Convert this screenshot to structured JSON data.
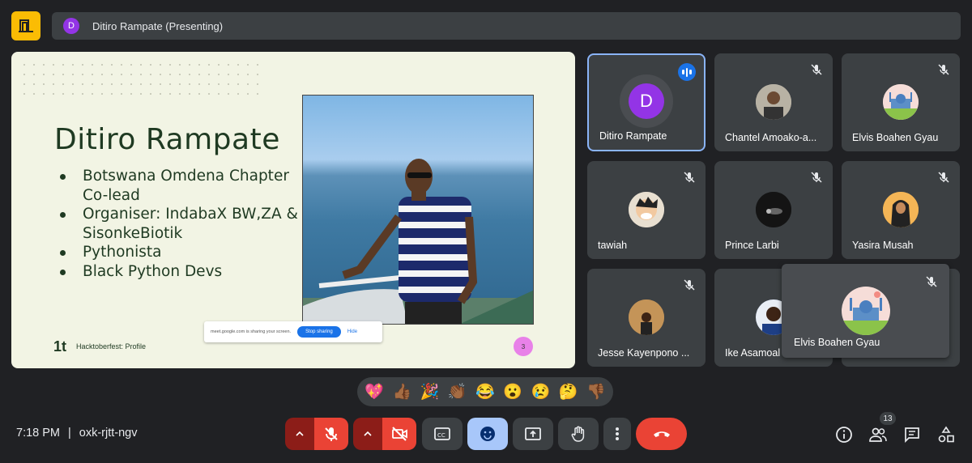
{
  "presenter_bar": {
    "initial": "D",
    "text": "Ditiro Rampate (Presenting)"
  },
  "slide": {
    "title": "Ditiro Rampate",
    "bullets": [
      "Botswana Omdena Chapter Co-lead",
      "Organiser: IndabaX BW,ZA & SisonkeBiotik",
      "Pythonista",
      "Black Python Devs"
    ],
    "brand_logo": "1t",
    "brand_text": "Hacktoberfest: Profile",
    "page_number": "3",
    "share_banner": {
      "text": "meet.google.com is sharing your screen.",
      "stop": "Stop sharing",
      "hide": "Hide"
    }
  },
  "participants": [
    {
      "name": "Ditiro Rampate",
      "initial": "D",
      "speaking": true
    },
    {
      "name": "Chantel Amoako-a...",
      "muted": true
    },
    {
      "name": "Elvis Boahen Gyau",
      "muted": true
    },
    {
      "name": "tawiah",
      "muted": true
    },
    {
      "name": "Prince Larbi",
      "muted": true
    },
    {
      "name": "Yasira Musah",
      "muted": true
    },
    {
      "name": "Jesse Kayenpono ...",
      "muted": true
    },
    {
      "name": "Ike Asamoal",
      "muted": true
    }
  ],
  "floating_tile": {
    "name": "Elvis Boahen Gyau"
  },
  "reactions": [
    "💖",
    "👍🏾",
    "🎉",
    "👏🏾",
    "😂",
    "😮",
    "😢",
    "🤔",
    "👎🏾"
  ],
  "bottom": {
    "time": "7:18 PM",
    "separator": "|",
    "meeting_code": "oxk-rjtt-ngv",
    "people_count": "13"
  },
  "colors": {
    "accent": "#8ab4f8",
    "danger": "#ea4335",
    "tile": "#3c4043",
    "background": "#202124"
  }
}
